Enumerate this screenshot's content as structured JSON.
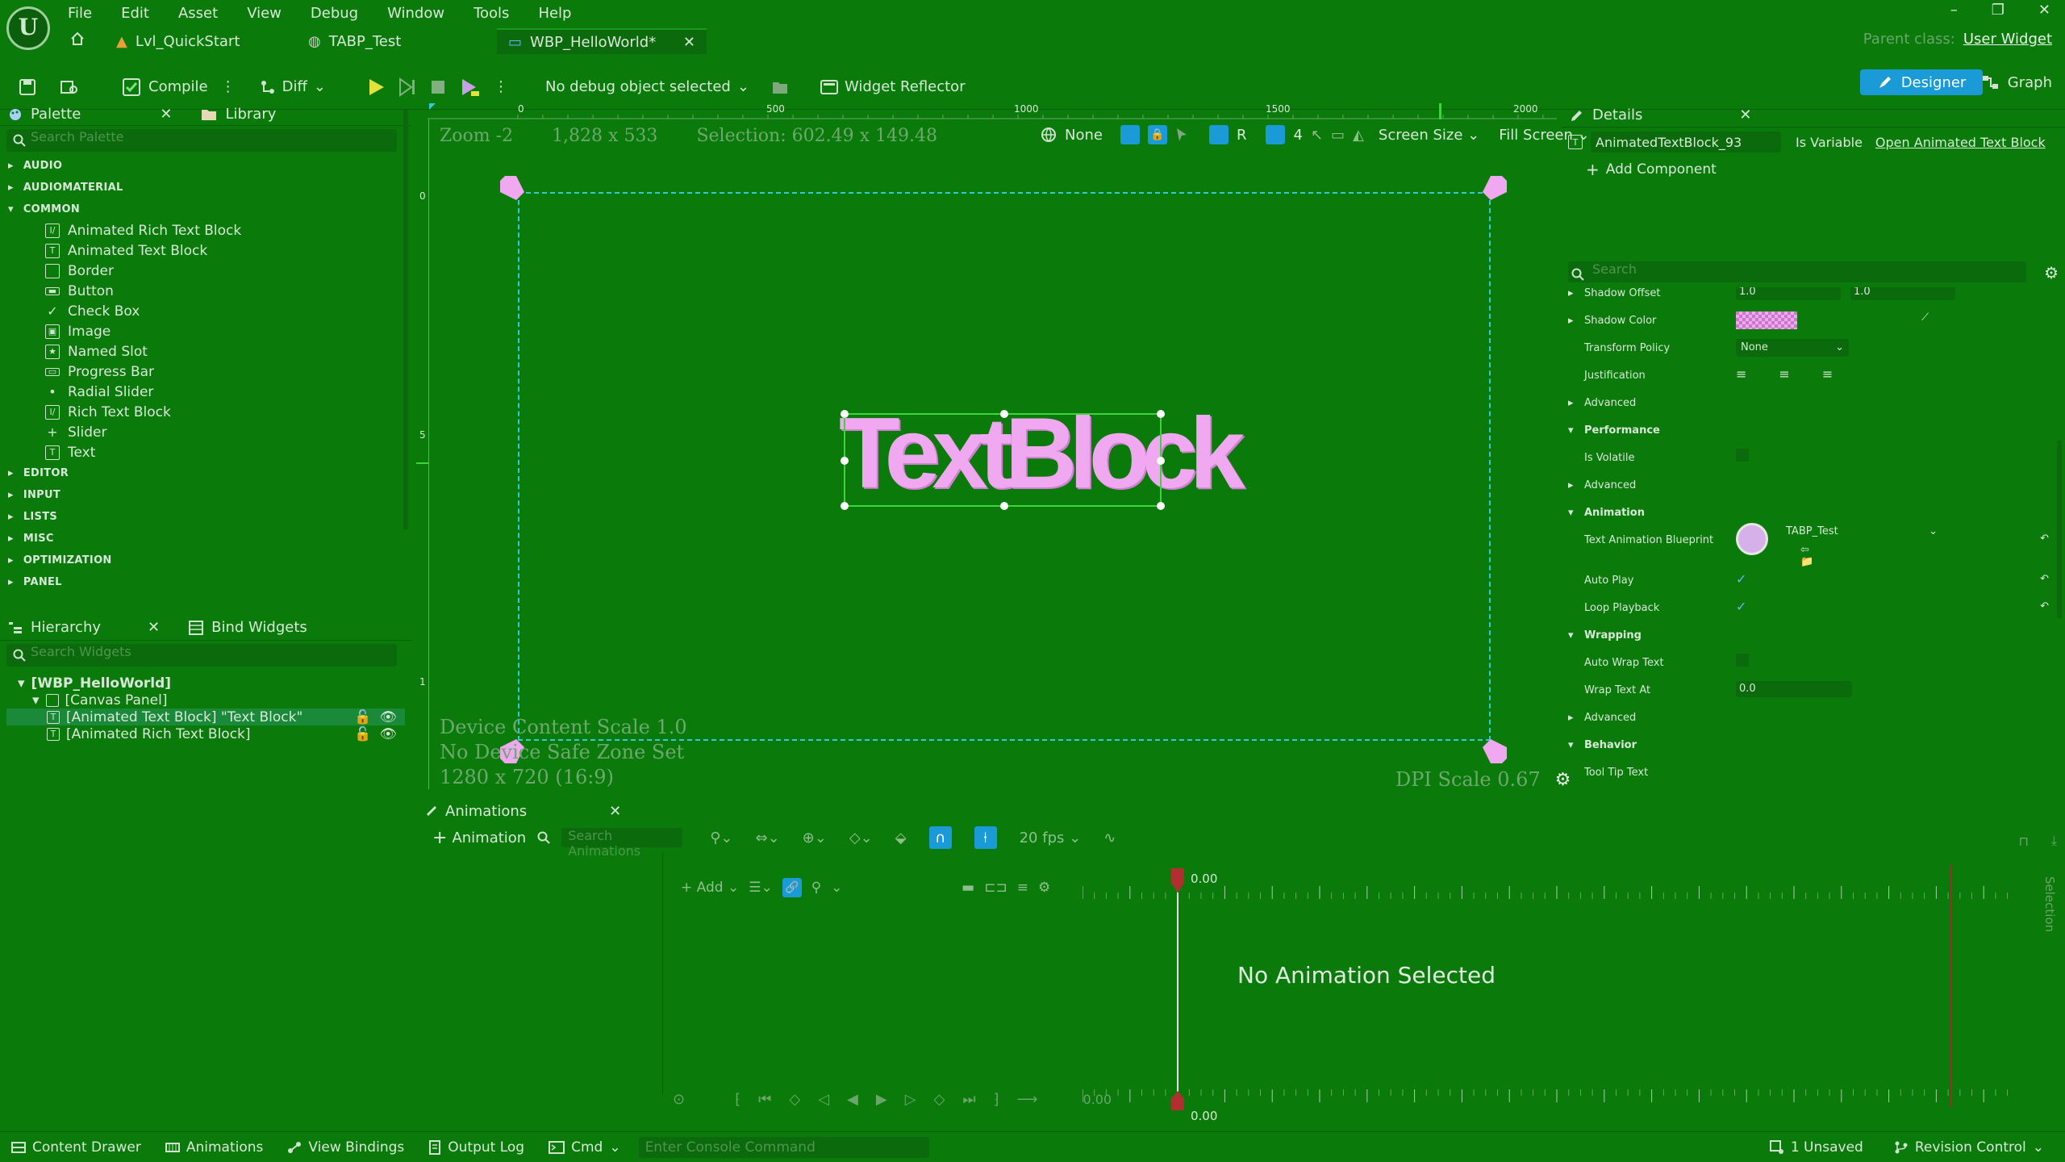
{
  "menu": [
    "File",
    "Edit",
    "Asset",
    "View",
    "Debug",
    "Window",
    "Tools",
    "Help"
  ],
  "tabs": [
    {
      "label": "Lvl_QuickStart",
      "active": false
    },
    {
      "label": "TABP_Test",
      "active": false
    },
    {
      "label": "WBP_HelloWorld*",
      "active": true
    }
  ],
  "parent_class": {
    "label": "Parent class:",
    "value": "User Widget"
  },
  "toolbar": {
    "compile": "Compile",
    "diff": "Diff",
    "debug_object": "No debug object selected",
    "widget_reflector": "Widget Reflector",
    "designer": "Designer",
    "graph": "Graph"
  },
  "palette": {
    "tab_palette": "Palette",
    "tab_library": "Library",
    "search_placeholder": "Search Palette",
    "categories_top": [
      "AUDIO",
      "AUDIOMATERIAL"
    ],
    "common_label": "COMMON",
    "common_items": [
      {
        "label": "Animated Rich Text Block",
        "icon": "rich-text-icon"
      },
      {
        "label": "Animated Text Block",
        "icon": "text-icon"
      },
      {
        "label": "Border",
        "icon": "border-icon"
      },
      {
        "label": "Button",
        "icon": "button-icon"
      },
      {
        "label": "Check Box",
        "icon": "check-icon"
      },
      {
        "label": "Image",
        "icon": "image-icon"
      },
      {
        "label": "Named Slot",
        "icon": "named-slot-icon"
      },
      {
        "label": "Progress Bar",
        "icon": "progress-bar-icon"
      },
      {
        "label": "Radial Slider",
        "icon": "radial-slider-icon"
      },
      {
        "label": "Rich Text Block",
        "icon": "rich-text-icon"
      },
      {
        "label": "Slider",
        "icon": "slider-icon"
      },
      {
        "label": "Text",
        "icon": "text-icon"
      }
    ],
    "categories_bottom": [
      "EDITOR",
      "INPUT",
      "LISTS",
      "MISC",
      "OPTIMIZATION",
      "PANEL"
    ]
  },
  "hierarchy": {
    "tab_hierarchy": "Hierarchy",
    "tab_bind": "Bind Widgets",
    "search_placeholder": "Search Widgets",
    "rows": [
      {
        "label": "[WBP_HelloWorld]",
        "indent": 0,
        "bold": true,
        "selected": false
      },
      {
        "label": "[Canvas Panel]",
        "indent": 1,
        "bold": false,
        "selected": false
      },
      {
        "label": "[Animated Text Block] \"Text Block\"",
        "indent": 2,
        "bold": false,
        "selected": true
      },
      {
        "label": "[Animated Rich Text Block]",
        "indent": 2,
        "bold": false,
        "selected": false
      }
    ]
  },
  "viewport": {
    "zoom": "Zoom -2",
    "size": "1,828 x 533",
    "selection": "Selection: 602.49 x 149.48",
    "ruler_h": [
      "0",
      "500",
      "1000",
      "1500",
      "2000"
    ],
    "ruler_v": [
      "0",
      "5",
      "1"
    ],
    "none_label": "None",
    "r_label": "R",
    "grid_value": "4",
    "screen_size": "Screen Size",
    "fill_screen": "Fill Screen",
    "widget_text": "TextBlock",
    "device_scale": "Device Content Scale 1.0",
    "safe_zone": "No Device Safe Zone Set",
    "resolution": "1280 x 720 (16:9)",
    "dpi": "DPI Scale 0.67"
  },
  "details": {
    "tab": "Details",
    "name": "AnimatedTextBlock_93",
    "is_variable": "Is Variable",
    "open_link": "Open Animated Text Block",
    "add_component": "Add Component",
    "search_placeholder": "Search",
    "rows": [
      {
        "label": "Shadow Offset",
        "kind": "prop",
        "expander": true,
        "v1": "1.0",
        "v2": "1.0"
      },
      {
        "label": "Shadow Color",
        "kind": "color",
        "expander": true
      },
      {
        "label": "Transform Policy",
        "kind": "dropdown",
        "value": "None"
      },
      {
        "label": "Justification",
        "kind": "justify"
      },
      {
        "label": "Advanced",
        "kind": "sub",
        "expander": true
      },
      {
        "label": "Performance",
        "kind": "section"
      },
      {
        "label": "Is Volatile",
        "kind": "checkbox",
        "checked": false
      },
      {
        "label": "Advanced",
        "kind": "sub",
        "expander": true
      },
      {
        "label": "Animation",
        "kind": "section"
      },
      {
        "label": "Text Animation Blueprint",
        "kind": "asset",
        "value": "TABP_Test"
      },
      {
        "label": "Auto Play",
        "kind": "checkbox",
        "checked": true
      },
      {
        "label": "Loop Playback",
        "kind": "checkbox",
        "checked": true
      },
      {
        "label": "Wrapping",
        "kind": "section"
      },
      {
        "label": "Auto Wrap Text",
        "kind": "checkbox",
        "checked": false
      },
      {
        "label": "Wrap Text At",
        "kind": "number",
        "value": "0.0"
      },
      {
        "label": "Advanced",
        "kind": "sub",
        "expander": true
      },
      {
        "label": "Behavior",
        "kind": "section"
      },
      {
        "label": "Tool Tip Text",
        "kind": "text"
      }
    ]
  },
  "animations": {
    "tab": "Animations",
    "add_animation": "Animation",
    "search_placeholder": "Search Animations",
    "fps": "20 fps",
    "add_track": "Add",
    "time_top": "0.00",
    "time_bottom": "0.00",
    "playback_time": "0.00",
    "empty": "No Animation Selected",
    "side_label": "Selection"
  },
  "statusbar": {
    "content_drawer": "Content Drawer",
    "animations": "Animations",
    "view_bindings": "View Bindings",
    "output_log": "Output Log",
    "cmd": "Cmd",
    "console_placeholder": "Enter Console Command",
    "unsaved": "1 Unsaved",
    "revision": "Revision Control"
  }
}
